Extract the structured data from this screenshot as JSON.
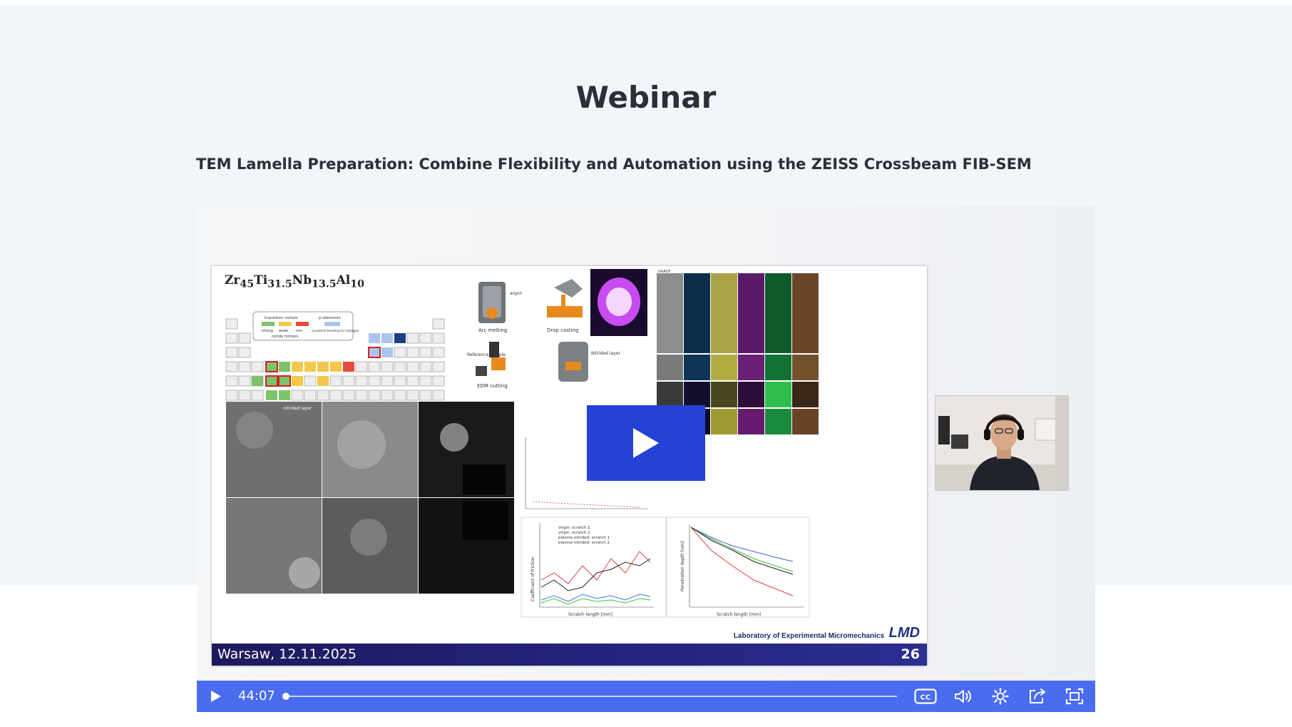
{
  "page": {
    "title": "Webinar",
    "subtitle": "TEM Lamella Preparation: Combine Flexibility and Automation using the ZEISS Crossbeam FIB-SEM"
  },
  "slide": {
    "formula_base": [
      "Zr",
      "Ti",
      "Nb",
      "Al"
    ],
    "formula_sub": [
      "45",
      "31.5",
      "13.5",
      "10"
    ],
    "footer_location": "Warsaw, 12.11.2025",
    "slide_number": "26",
    "lab_name": "Laboratory of Experimental Micromechanics",
    "lab_logo": "LMD",
    "labels": {
      "arc_melting": "Arc melting",
      "drop_casting": "Drop casting",
      "edm_cutting": "EDM cutting",
      "reference_sample": "Reference sample",
      "nitrided_layer": "Nitrided layer",
      "argon": "argon",
      "nitrided_layer_small": "nitrided layer",
      "legend_transition": "transition metals",
      "legend_p": "p-elements",
      "legend_strong": "strong",
      "legend_weak": "weak",
      "legend_non": "non",
      "legend_nitride": "nitride formers",
      "legend_covalent": "covalent bonding to nitrogen",
      "haadf": "HAADF",
      "coef_friction": "Coefficient of friction",
      "penetration_depth": "Penetration depth [nm]",
      "scratch_length": "Scratch length [mm]",
      "legend_virgin1": "virgin: scratch 1",
      "legend_virgin2": "virgin: scratch 2",
      "legend_pn1": "plasma nitrided: scratch 1",
      "legend_pn2": "plasma nitrided: scratch 2"
    }
  },
  "player": {
    "time": "44:07",
    "progress": 0.005,
    "accent_color": "#4a6cf0",
    "overlay_color": "#2443d6",
    "icons": [
      "play-icon",
      "captions-icon",
      "volume-icon",
      "settings-icon",
      "share-icon",
      "fullscreen-icon"
    ]
  }
}
